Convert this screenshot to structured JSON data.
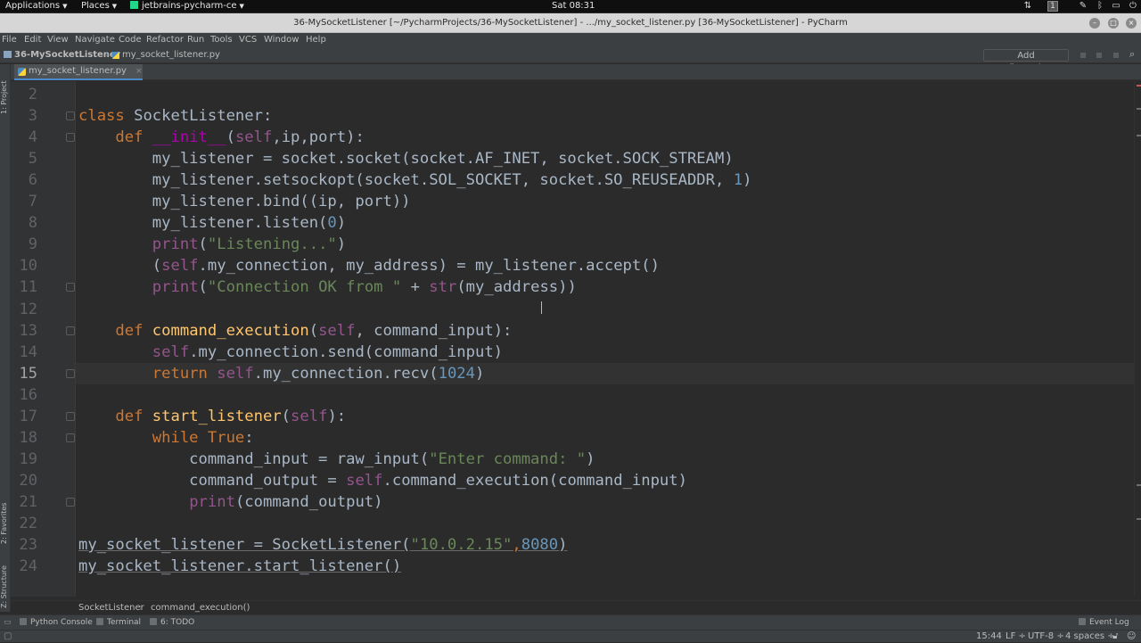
{
  "system_panel": {
    "applications": "Applications",
    "places": "Places",
    "task": "jetbrains-pycharm-ce",
    "clock": "Sat 08:31",
    "workspace": "1"
  },
  "window": {
    "title": "36-MySocketListener [~/PycharmProjects/36-MySocketListener] - .../my_socket_listener.py [36-MySocketListener] - PyCharm"
  },
  "menu": [
    "File",
    "Edit",
    "View",
    "Navigate",
    "Code",
    "Refactor",
    "Run",
    "Tools",
    "VCS",
    "Window",
    "Help"
  ],
  "nav": {
    "project": "36-MySocketListener",
    "file": "my_socket_listener.py",
    "add_configuration": "Add Configuration..."
  },
  "tabs": [
    {
      "label": "my_socket_listener.py",
      "close": "×"
    }
  ],
  "left_stripe": {
    "project": "1: Project",
    "favorites": "2: Favorites",
    "structure": "Z: Structure"
  },
  "editor": {
    "current_line": 15,
    "lines": [
      {
        "n": "2",
        "tokens": []
      },
      {
        "n": "3",
        "tokens": [
          {
            "t": "class ",
            "c": "kw"
          },
          {
            "t": "SocketListener:",
            "c": "plain"
          }
        ]
      },
      {
        "n": "4",
        "tokens": [
          {
            "t": "    def ",
            "c": "kw"
          },
          {
            "t": "__init__",
            "c": "magic"
          },
          {
            "t": "(",
            "c": "plain"
          },
          {
            "t": "self",
            "c": "self"
          },
          {
            "t": ",ip,port):",
            "c": "plain"
          }
        ]
      },
      {
        "n": "5",
        "tokens": [
          {
            "t": "        my_listener = socket.socket(socket.AF_INET, socket.SOCK_STREAM)",
            "c": "plain"
          }
        ]
      },
      {
        "n": "6",
        "tokens": [
          {
            "t": "        my_listener.setsockopt(socket.SOL_SOCKET, socket.SO_REUSEADDR, ",
            "c": "plain"
          },
          {
            "t": "1",
            "c": "num"
          },
          {
            "t": ")",
            "c": "plain"
          }
        ]
      },
      {
        "n": "7",
        "tokens": [
          {
            "t": "        my_listener.bind((ip, port))",
            "c": "plain"
          }
        ]
      },
      {
        "n": "8",
        "tokens": [
          {
            "t": "        my_listener.listen(",
            "c": "plain"
          },
          {
            "t": "0",
            "c": "num"
          },
          {
            "t": ")",
            "c": "plain"
          }
        ]
      },
      {
        "n": "9",
        "tokens": [
          {
            "t": "        ",
            "c": "plain"
          },
          {
            "t": "print",
            "c": "self"
          },
          {
            "t": "(",
            "c": "plain"
          },
          {
            "t": "\"Listening...\"",
            "c": "str"
          },
          {
            "t": ")",
            "c": "plain"
          }
        ]
      },
      {
        "n": "10",
        "tokens": [
          {
            "t": "        (",
            "c": "plain"
          },
          {
            "t": "self",
            "c": "self"
          },
          {
            "t": ".my_connection, my_address) = my_listener.accept()",
            "c": "plain"
          }
        ]
      },
      {
        "n": "11",
        "tokens": [
          {
            "t": "        ",
            "c": "plain"
          },
          {
            "t": "print",
            "c": "self"
          },
          {
            "t": "(",
            "c": "plain"
          },
          {
            "t": "\"Connection OK from \"",
            "c": "str"
          },
          {
            "t": " + ",
            "c": "plain"
          },
          {
            "t": "str",
            "c": "self"
          },
          {
            "t": "(my_address))",
            "c": "plain"
          }
        ]
      },
      {
        "n": "12",
        "tokens": []
      },
      {
        "n": "13",
        "tokens": [
          {
            "t": "    def ",
            "c": "kw"
          },
          {
            "t": "command_execution",
            "c": "fn"
          },
          {
            "t": "(",
            "c": "plain"
          },
          {
            "t": "self",
            "c": "self"
          },
          {
            "t": ", command_input):",
            "c": "plain"
          }
        ]
      },
      {
        "n": "14",
        "tokens": [
          {
            "t": "        ",
            "c": "plain"
          },
          {
            "t": "self",
            "c": "self"
          },
          {
            "t": ".my_connection.send(command_input)",
            "c": "plain"
          }
        ]
      },
      {
        "n": "15",
        "tokens": [
          {
            "t": "        return ",
            "c": "kw"
          },
          {
            "t": "self",
            "c": "self"
          },
          {
            "t": ".my_connection.recv(",
            "c": "plain"
          },
          {
            "t": "1024",
            "c": "num"
          },
          {
            "t": ")",
            "c": "plain"
          }
        ]
      },
      {
        "n": "16",
        "tokens": []
      },
      {
        "n": "17",
        "tokens": [
          {
            "t": "    def ",
            "c": "kw"
          },
          {
            "t": "start_listener",
            "c": "fn"
          },
          {
            "t": "(",
            "c": "plain"
          },
          {
            "t": "self",
            "c": "self"
          },
          {
            "t": "):",
            "c": "plain"
          }
        ]
      },
      {
        "n": "18",
        "tokens": [
          {
            "t": "        while True",
            "c": "kw"
          },
          {
            "t": ":",
            "c": "plain"
          }
        ]
      },
      {
        "n": "19",
        "tokens": [
          {
            "t": "            command_input = raw_input(",
            "c": "plain"
          },
          {
            "t": "\"Enter command: \"",
            "c": "str"
          },
          {
            "t": ")",
            "c": "plain"
          }
        ]
      },
      {
        "n": "20",
        "tokens": [
          {
            "t": "            command_output = ",
            "c": "plain"
          },
          {
            "t": "self",
            "c": "self"
          },
          {
            "t": ".command_execution(command_input)",
            "c": "plain"
          }
        ]
      },
      {
        "n": "21",
        "tokens": [
          {
            "t": "            ",
            "c": "plain"
          },
          {
            "t": "print",
            "c": "self"
          },
          {
            "t": "(command_output)",
            "c": "plain"
          }
        ]
      },
      {
        "n": "22",
        "tokens": []
      },
      {
        "n": "23",
        "tokens": [
          {
            "t": "my_socket_listener = SocketListener(",
            "c": "plain"
          },
          {
            "t": "\"10.0.2.15\"",
            "c": "str"
          },
          {
            "t": ",",
            "c": "kw"
          },
          {
            "t": "8080",
            "c": "num"
          },
          {
            "t": ")",
            "c": "plain"
          }
        ]
      },
      {
        "n": "24",
        "tokens": [
          {
            "t": "my_socket_listener.start_listener()",
            "c": "plain"
          }
        ]
      }
    ]
  },
  "breadcrumbs": [
    "SocketListener",
    "command_execution()"
  ],
  "tool_windows": {
    "python_console": "Python Console",
    "terminal": "Terminal",
    "todo": "6: TODO",
    "event_log": "Event Log"
  },
  "status": {
    "position": "15:44",
    "line_sep": "LF ÷",
    "encoding": "UTF-8 ÷",
    "indent": "4 spaces ÷"
  }
}
